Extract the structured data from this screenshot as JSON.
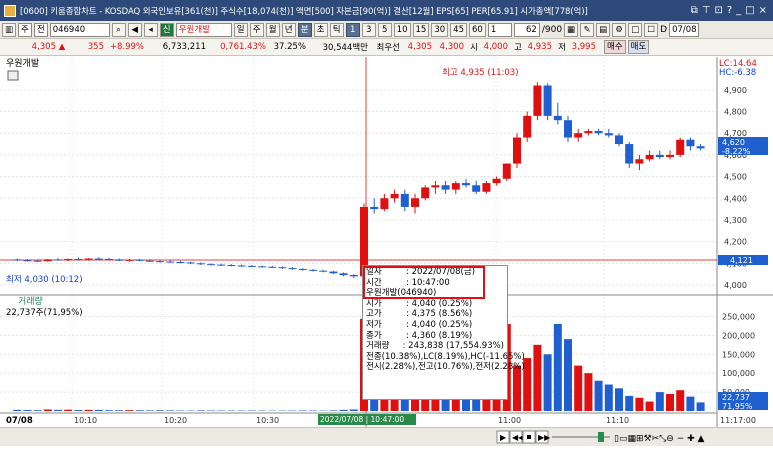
{
  "title": "[0600] 키움종합차트 - KOSDAQ 외국인보유[361(천)] 주식수[18,074(천)] 액면[500] 자본금[90(억)] 결산[12월] EPS[65] PER[65.91] 시가총액[778(억)]",
  "toolbar": {
    "market": "주",
    "type": "전",
    "code": "046940",
    "stock_name": "우원개발",
    "periods": [
      "일",
      "주",
      "월",
      "년",
      "분",
      "초",
      "틱"
    ],
    "minutes": [
      "1",
      "3",
      "5",
      "10",
      "15",
      "30",
      "45",
      "60"
    ],
    "unit_value": "1",
    "count": "62",
    "count_total": "/900",
    "date": "07/08"
  },
  "quote": {
    "price": "4,305",
    "change": "355",
    "change_pct": "+8.99%",
    "volume": "6,733,211",
    "volume_pct": "0,761.43%",
    "turnover": "37.25%",
    "amount": "30,544백만",
    "tag": "최우선",
    "bid1": "4,305",
    "ask1": "4,300",
    "open_label": "시",
    "open": "4,000",
    "high_label": "고",
    "high": "4,935",
    "low_label": "저",
    "low": "3,995",
    "buy": "매수",
    "sell": "매도"
  },
  "price_pane": {
    "label": "우원개발",
    "high_marker": "최고 4,935 (11:03)",
    "low_marker": "최저 4,030 (10:12)",
    "lc": "LC:14.64",
    "hc": "HC:-6.38",
    "current": "4,620",
    "current_pct": "-8.22%",
    "ref_price": "4,121",
    "ticks": [
      "4,900",
      "4,800",
      "4,700",
      "4,600",
      "4,500",
      "4,400",
      "4,300",
      "4,200",
      "4,100",
      "4,000"
    ]
  },
  "volume_pane": {
    "label": "거래량",
    "value": "22,737주(71,95%)",
    "ticks": [
      "250,000",
      "200,000",
      "150,000",
      "100,000",
      "50,000"
    ],
    "current": "22,737",
    "current_pct": "71,95%"
  },
  "xaxis": {
    "date": "07/08",
    "ticks": [
      "10:10",
      "10:20",
      "10:30",
      "11:00",
      "11:10",
      "11:17:00"
    ],
    "cursor_label": "2022/07/08 | 10:47:00"
  },
  "tooltip": {
    "rows": [
      [
        "일자",
        ": 2022/07/08(금)"
      ],
      [
        "시간",
        ": 10:47:00"
      ]
    ],
    "name": "우원개발(046940)",
    "data": [
      [
        "시가",
        ": 4,040 (0.25%)"
      ],
      [
        "고가",
        ": 4,375 (8.56%)"
      ],
      [
        "저가",
        ": 4,040 (0.25%)"
      ],
      [
        "종가",
        ": 4,360 (8.19%)"
      ],
      [
        "거래량",
        ": 243,838 (17,554.93%)"
      ]
    ],
    "line1": "전종(10.38%),LC(8.19%),HC(-11.65%)",
    "line2": "전시(2.28%),전고(10.76%),전저(2.28%)"
  },
  "candles": [
    [
      4118,
      4122,
      4110,
      4114
    ],
    [
      4114,
      4120,
      4108,
      4112
    ],
    [
      4112,
      4118,
      4106,
      4110
    ],
    [
      4110,
      4120,
      4108,
      4118
    ],
    [
      4118,
      4124,
      4112,
      4116
    ],
    [
      4116,
      4122,
      4110,
      4120
    ],
    [
      4120,
      4126,
      4114,
      4118
    ],
    [
      4118,
      4124,
      4112,
      4122
    ],
    [
      4122,
      4128,
      4116,
      4120
    ],
    [
      4120,
      4126,
      4114,
      4118
    ],
    [
      4118,
      4122,
      4110,
      4112
    ],
    [
      4112,
      4120,
      4108,
      4116
    ],
    [
      4116,
      4120,
      4110,
      4112
    ],
    [
      4112,
      4118,
      4106,
      4110
    ],
    [
      4110,
      4116,
      4104,
      4108
    ],
    [
      4108,
      4114,
      4102,
      4106
    ],
    [
      4106,
      4112,
      4100,
      4104
    ],
    [
      4104,
      4108,
      4096,
      4100
    ],
    [
      4100,
      4104,
      4092,
      4096
    ],
    [
      4096,
      4100,
      4090,
      4094
    ],
    [
      4094,
      4098,
      4088,
      4092
    ],
    [
      4092,
      4096,
      4086,
      4090
    ],
    [
      4090,
      4094,
      4084,
      4088
    ],
    [
      4088,
      4092,
      4082,
      4086
    ],
    [
      4086,
      4090,
      4080,
      4084
    ],
    [
      4084,
      4088,
      4078,
      4082
    ],
    [
      4082,
      4086,
      4074,
      4078
    ],
    [
      4078,
      4082,
      4070,
      4074
    ],
    [
      4074,
      4078,
      4066,
      4070
    ],
    [
      4070,
      4074,
      4062,
      4066
    ],
    [
      4066,
      4070,
      4058,
      4062
    ],
    [
      4062,
      4066,
      4050,
      4054
    ],
    [
      4054,
      4058,
      4040,
      4046
    ],
    [
      4046,
      4050,
      4032,
      4040
    ],
    [
      4040,
      4375,
      4040,
      4360
    ],
    [
      4360,
      4400,
      4330,
      4350
    ],
    [
      4350,
      4420,
      4340,
      4400
    ],
    [
      4400,
      4440,
      4380,
      4420
    ],
    [
      4420,
      4440,
      4340,
      4360
    ],
    [
      4360,
      4420,
      4330,
      4400
    ],
    [
      4400,
      4460,
      4390,
      4450
    ],
    [
      4450,
      4480,
      4420,
      4460
    ],
    [
      4460,
      4480,
      4420,
      4440
    ],
    [
      4440,
      4480,
      4420,
      4470
    ],
    [
      4470,
      4490,
      4450,
      4460
    ],
    [
      4460,
      4480,
      4420,
      4430
    ],
    [
      4430,
      4480,
      4420,
      4470
    ],
    [
      4470,
      4500,
      4460,
      4490
    ],
    [
      4490,
      4560,
      4480,
      4560
    ],
    [
      4560,
      4700,
      4540,
      4680
    ],
    [
      4680,
      4800,
      4660,
      4780
    ],
    [
      4780,
      4935,
      4760,
      4920
    ],
    [
      4920,
      4930,
      4760,
      4780
    ],
    [
      4780,
      4840,
      4740,
      4760
    ],
    [
      4760,
      4780,
      4660,
      4680
    ],
    [
      4680,
      4720,
      4660,
      4700
    ],
    [
      4700,
      4720,
      4690,
      4710
    ],
    [
      4710,
      4720,
      4690,
      4700
    ],
    [
      4700,
      4720,
      4680,
      4690
    ],
    [
      4690,
      4700,
      4640,
      4650
    ],
    [
      4650,
      4660,
      4540,
      4560
    ],
    [
      4560,
      4600,
      4530,
      4580
    ],
    [
      4580,
      4620,
      4570,
      4600
    ],
    [
      4600,
      4620,
      4580,
      4590
    ],
    [
      4590,
      4620,
      4580,
      4600
    ],
    [
      4600,
      4680,
      4590,
      4670
    ],
    [
      4670,
      4680,
      4620,
      4640
    ],
    [
      4640,
      4650,
      4620,
      4630
    ]
  ],
  "volumes": [
    3000,
    2500,
    2000,
    4000,
    3000,
    3500,
    2500,
    3000,
    2800,
    2000,
    1800,
    2200,
    2000,
    1500,
    1800,
    1500,
    1200,
    1000,
    1500,
    1300,
    1200,
    1100,
    1000,
    1200,
    1000,
    900,
    1000,
    1100,
    1300,
    1200,
    1000,
    1500,
    3000,
    4000,
    243838,
    120000,
    90000,
    150000,
    70000,
    80000,
    110000,
    90000,
    60000,
    100000,
    130000,
    80000,
    150000,
    210000,
    230000,
    120000,
    140000,
    175000,
    150000,
    230000,
    190000,
    120000,
    100000,
    80000,
    70000,
    60000,
    40000,
    35000,
    25000,
    50000,
    45000,
    55000,
    38000,
    22737
  ]
}
